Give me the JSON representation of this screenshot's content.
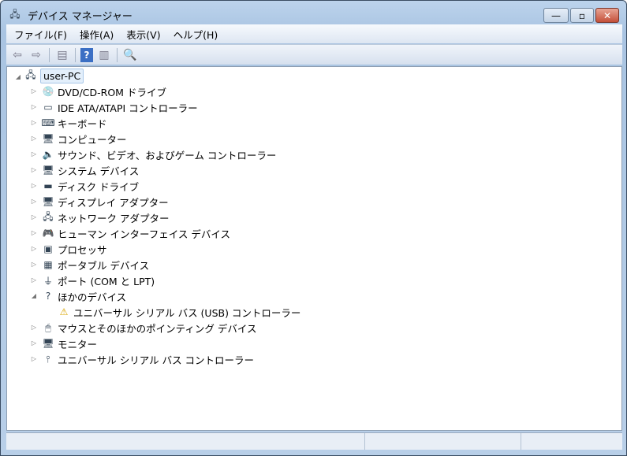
{
  "window": {
    "title": "デバイス マネージャー",
    "minimize": "—",
    "maximize": "▫",
    "close": "✕"
  },
  "menu": [
    "ファイル(F)",
    "操作(A)",
    "表示(V)",
    "ヘルプ(H)"
  ],
  "toolbar": [
    "back",
    "forward",
    "show-hide-console-tree",
    "help",
    "show-action-pane",
    "scan-hardware"
  ],
  "tree": {
    "root": "user-PC",
    "items": [
      {
        "label": "DVD/CD-ROM ドライブ",
        "icon": "dvd-icon"
      },
      {
        "label": "IDE ATA/ATAPI コントローラー",
        "icon": "ide-icon"
      },
      {
        "label": "キーボード",
        "icon": "keyboard-icon"
      },
      {
        "label": "コンピューター",
        "icon": "computer-icon"
      },
      {
        "label": "サウンド、ビデオ、およびゲーム コントローラー",
        "icon": "speaker-icon"
      },
      {
        "label": "システム デバイス",
        "icon": "system-icon"
      },
      {
        "label": "ディスク ドライブ",
        "icon": "disk-icon"
      },
      {
        "label": "ディスプレイ アダプター",
        "icon": "display-icon"
      },
      {
        "label": "ネットワーク アダプター",
        "icon": "network-icon"
      },
      {
        "label": "ヒューマン インターフェイス デバイス",
        "icon": "hid-icon"
      },
      {
        "label": "プロセッサ",
        "icon": "cpu-icon"
      },
      {
        "label": "ポータブル デバイス",
        "icon": "portable-icon"
      },
      {
        "label": "ポート (COM と LPT)",
        "icon": "port-icon"
      },
      {
        "label": "ほかのデバイス",
        "icon": "unknown-device-icon",
        "expanded": true
      },
      {
        "label": "ユニバーサル シリアル バス (USB) コントローラー",
        "icon": "warning-icon",
        "child": true
      },
      {
        "label": "マウスとそのほかのポインティング デバイス",
        "icon": "mouse-icon"
      },
      {
        "label": "モニター",
        "icon": "monitor-icon"
      },
      {
        "label": "ユニバーサル シリアル バス コントローラー",
        "icon": "usb-icon"
      }
    ]
  }
}
